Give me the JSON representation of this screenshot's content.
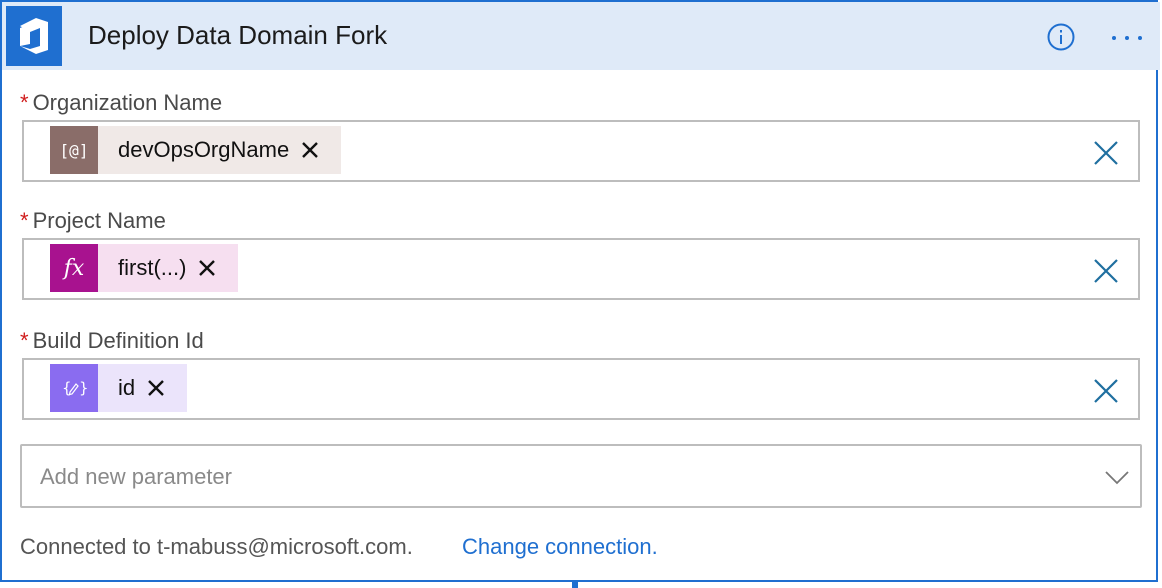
{
  "header": {
    "title": "Deploy Data Domain Fork",
    "logo_icon": "azure-devops-logo",
    "info_icon": "info-icon",
    "more_icon": "more-options-icon"
  },
  "fields": [
    {
      "label": "Organization Name",
      "required_mark": "*",
      "token_icon": "variable-icon",
      "token_icon_text": "[@]",
      "token_text": "devOpsOrgName",
      "token_color": "#f0e9e7",
      "icon_color": "#8a6d69"
    },
    {
      "label": "Project Name",
      "required_mark": "*",
      "token_icon": "function-icon",
      "token_icon_text": "fx",
      "token_text": "first(...)",
      "token_color": "#f6dff0",
      "icon_color": "#a8128f"
    },
    {
      "label": "Build Definition Id",
      "required_mark": "*",
      "token_icon": "dynamic-content-icon",
      "token_icon_text": "{⁠}",
      "token_text": "id",
      "token_color": "#ebe4fb",
      "icon_color": "#8a6cf0"
    }
  ],
  "add_parameter": {
    "placeholder": "Add new parameter"
  },
  "footer": {
    "connected_text": "Connected to t-mabuss@microsoft.com.",
    "change_link": "Change connection."
  },
  "colors": {
    "accent": "#1f6fd0",
    "required": "#d01c1c",
    "header_bg": "#dfeaf8"
  }
}
